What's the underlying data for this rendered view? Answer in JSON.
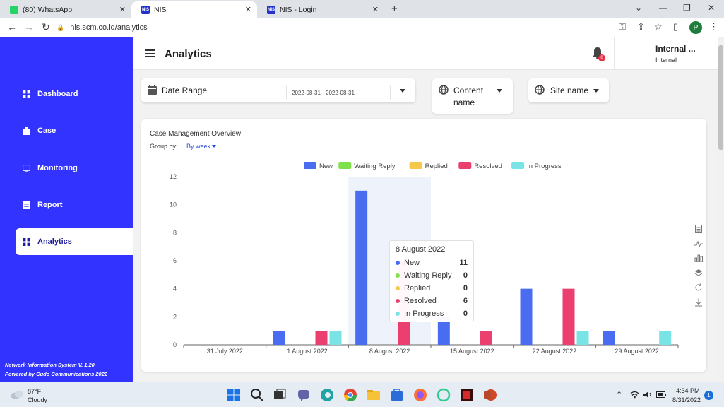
{
  "browser": {
    "tabs": [
      {
        "label": "(80) WhatsApp",
        "icon": "whatsapp-icon"
      },
      {
        "label": "NIS",
        "icon": "nis-icon",
        "active": true
      },
      {
        "label": "NIS - Login",
        "icon": "nis-icon"
      }
    ],
    "fav_text": "NIS",
    "url": "nis.scm.co.id/analytics",
    "profile_initial": "P"
  },
  "sidebar": {
    "items": [
      {
        "label": "Dashboard",
        "icon": "dashboard-icon"
      },
      {
        "label": "Case",
        "icon": "case-icon"
      },
      {
        "label": "Monitoring",
        "icon": "monitoring-icon"
      },
      {
        "label": "Report",
        "icon": "report-icon"
      },
      {
        "label": "Analytics",
        "icon": "analytics-icon",
        "active": true
      }
    ],
    "footer_line1": "Network Information System V. 1.20",
    "footer_line2": "Powered by Cudo Communications 2022",
    "color": "#3333ff"
  },
  "header": {
    "title": "Analytics",
    "notification_count": "0",
    "user_name": "Internal ...",
    "user_role": "Internal"
  },
  "filters": {
    "date_range_label": "Date Range",
    "date_range_value": "2022-08-31 - 2022-08-31",
    "content_name_label_1": "Content",
    "content_name_label_2": "name",
    "site_name_label": "Site name"
  },
  "chart_data": {
    "type": "bar",
    "title": "Case Management Overview",
    "group_by_label": "Group by:",
    "group_by_value": "By week",
    "categories": [
      "31 July 2022",
      "1 August 2022",
      "8 August 2022",
      "15 August 2022",
      "22 August 2022",
      "29 August 2022"
    ],
    "ylim": [
      0,
      12
    ],
    "yticks": [
      0,
      2,
      4,
      6,
      8,
      10,
      12
    ],
    "legend_position": "top",
    "series": [
      {
        "name": "New",
        "color": "#4a6cf0",
        "values": [
          0,
          1,
          11,
          2,
          4,
          1
        ]
      },
      {
        "name": "Waiting Reply",
        "color": "#7ee04a",
        "values": [
          0,
          0,
          0,
          0,
          0,
          0
        ]
      },
      {
        "name": "Replied",
        "color": "#f5c84a",
        "values": [
          0,
          0,
          0,
          0,
          0,
          0
        ]
      },
      {
        "name": "Resolved",
        "color": "#ea3f6f",
        "values": [
          0,
          1,
          6,
          1,
          4,
          0
        ]
      },
      {
        "name": "In Progress",
        "color": "#7ae3e6",
        "values": [
          0,
          1,
          0,
          0,
          1,
          1
        ]
      }
    ],
    "highlighted_category": "8 August 2022"
  },
  "tooltip": {
    "title": "8 August 2022",
    "rows": [
      {
        "name": "New",
        "value": "11"
      },
      {
        "name": "Waiting Reply",
        "value": "0"
      },
      {
        "name": "Replied",
        "value": "0"
      },
      {
        "name": "Resolved",
        "value": "6"
      },
      {
        "name": "In Progress",
        "value": "0"
      }
    ]
  },
  "toolbox": [
    "data-view-icon",
    "line-chart-icon",
    "bar-chart-icon",
    "stack-icon",
    "restore-icon",
    "download-icon"
  ],
  "taskbar": {
    "temperature": "87°F",
    "weather": "Cloudy",
    "time": "4:34 PM",
    "date": "8/31/2022",
    "notification_count": "1"
  }
}
